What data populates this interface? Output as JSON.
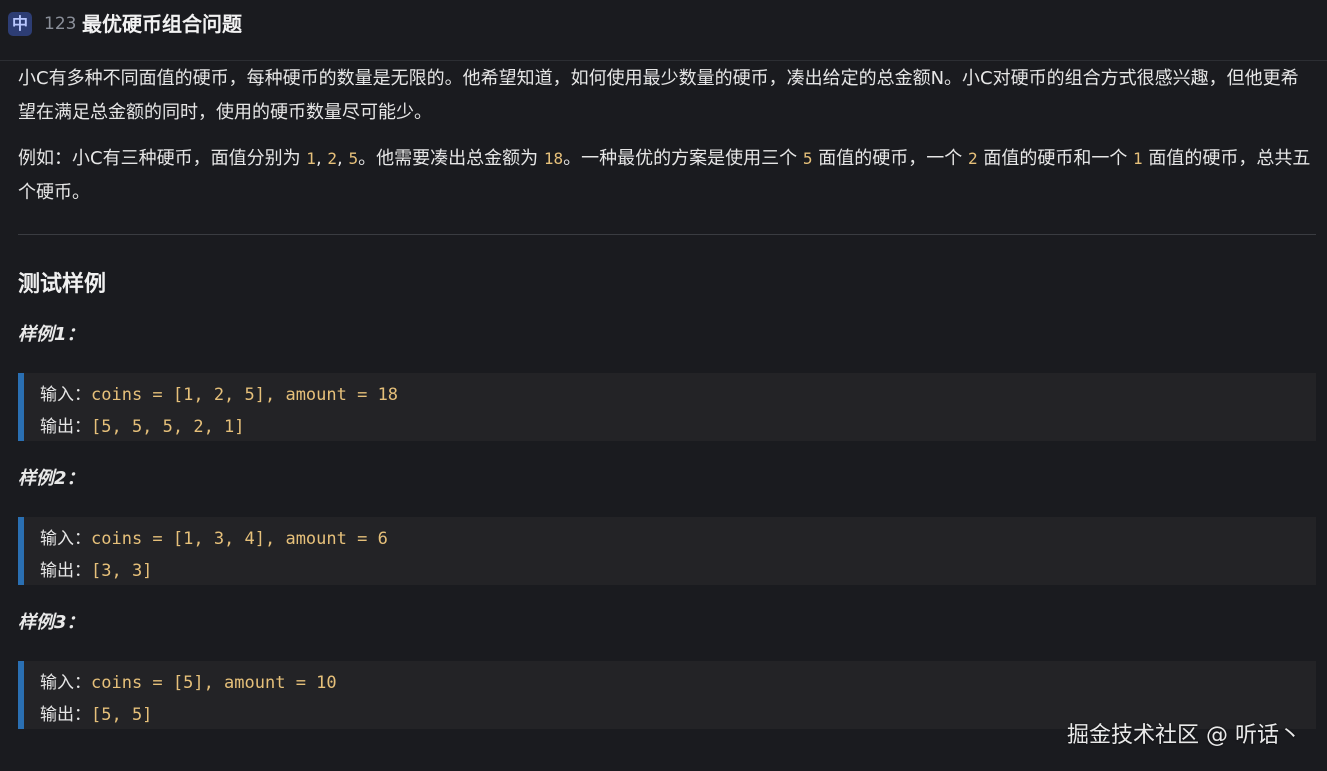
{
  "header": {
    "badge": "中",
    "number": "123",
    "title": "最优硬币组合问题"
  },
  "description": {
    "p1": "小C有多种不同面值的硬币，每种硬币的数量是无限的。他希望知道，如何使用最少数量的硬币，凑出给定的总金额N。小C对硬币的组合方式很感兴趣，但他更希望在满足总金额的同时，使用的硬币数量尽可能少。",
    "p2_parts": [
      "例如：小C有三种硬币，面值分别为 ",
      "1",
      ", ",
      "2",
      ", ",
      "5",
      "。他需要凑出总金额为 ",
      "18",
      "。一种最优的方案是使用三个 ",
      "5",
      " 面值的硬币，一个 ",
      "2",
      " 面值的硬币和一个 ",
      "1",
      " 面值的硬币，总共五个硬币。"
    ]
  },
  "samples": {
    "title": "测试样例",
    "items": [
      {
        "label": "样例1：",
        "input_label": "输入：",
        "input_value": "coins = [1, 2, 5], amount = 18",
        "output_label": "输出：",
        "output_value": "[5, 5, 5, 2, 1]"
      },
      {
        "label": "样例2：",
        "input_label": "输入：",
        "input_value": "coins = [1, 3, 4], amount = 6",
        "output_label": "输出：",
        "output_value": "[3, 3]"
      },
      {
        "label": "样例3：",
        "input_label": "输入：",
        "input_value": "coins = [5], amount = 10",
        "output_label": "输出：",
        "output_value": "[5, 5]"
      }
    ]
  },
  "watermark": "掘金技术社区 @ 听话丶",
  "colors": {
    "background": "#1a1b1f",
    "accent_bar": "#2a6fb2",
    "number_highlight": "#e6c07a"
  }
}
